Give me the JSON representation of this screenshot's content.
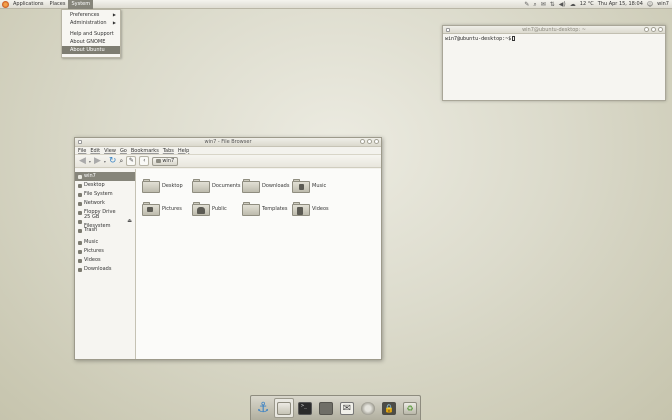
{
  "top_panel": {
    "menus": [
      "Applications",
      "Places",
      "System"
    ],
    "active_menu": "System",
    "temperature": "12 °C",
    "clock": "Thu Apr 15, 18:04",
    "user": "win7"
  },
  "system_menu": {
    "items": [
      {
        "label": "Preferences",
        "submenu": true
      },
      {
        "label": "Administration",
        "submenu": true
      },
      {
        "label": "Help and Support",
        "submenu": false
      },
      {
        "label": "About GNOME",
        "submenu": false
      },
      {
        "label": "About Ubuntu",
        "submenu": false,
        "highlighted": true
      }
    ]
  },
  "terminal": {
    "title": "win7@ubuntu-desktop: ~",
    "prompt": "win7@ubuntu-desktop:~$"
  },
  "file_browser": {
    "title": "win7 - File Browser",
    "menubar": [
      "File",
      "Edit",
      "View",
      "Go",
      "Bookmarks",
      "Tabs",
      "Help"
    ],
    "location": "win7",
    "sidebar": [
      "win7",
      "Desktop",
      "File System",
      "Network",
      "Floppy Drive",
      "25 GB Filesystem",
      "Trash",
      "Music",
      "Pictures",
      "Videos",
      "Downloads"
    ],
    "selected_sidebar": "win7",
    "folders": [
      "Desktop",
      "Documents",
      "Downloads",
      "Music",
      "Pictures",
      "Public",
      "Templates",
      "Videos"
    ]
  },
  "dock": {
    "items": [
      "anchor",
      "file-manager",
      "terminal",
      "files",
      "mail",
      "disk",
      "lock",
      "trash"
    ],
    "active_index": 1
  },
  "colors": {
    "selection": "#86857a",
    "accent_blue": "#3b82c4"
  }
}
